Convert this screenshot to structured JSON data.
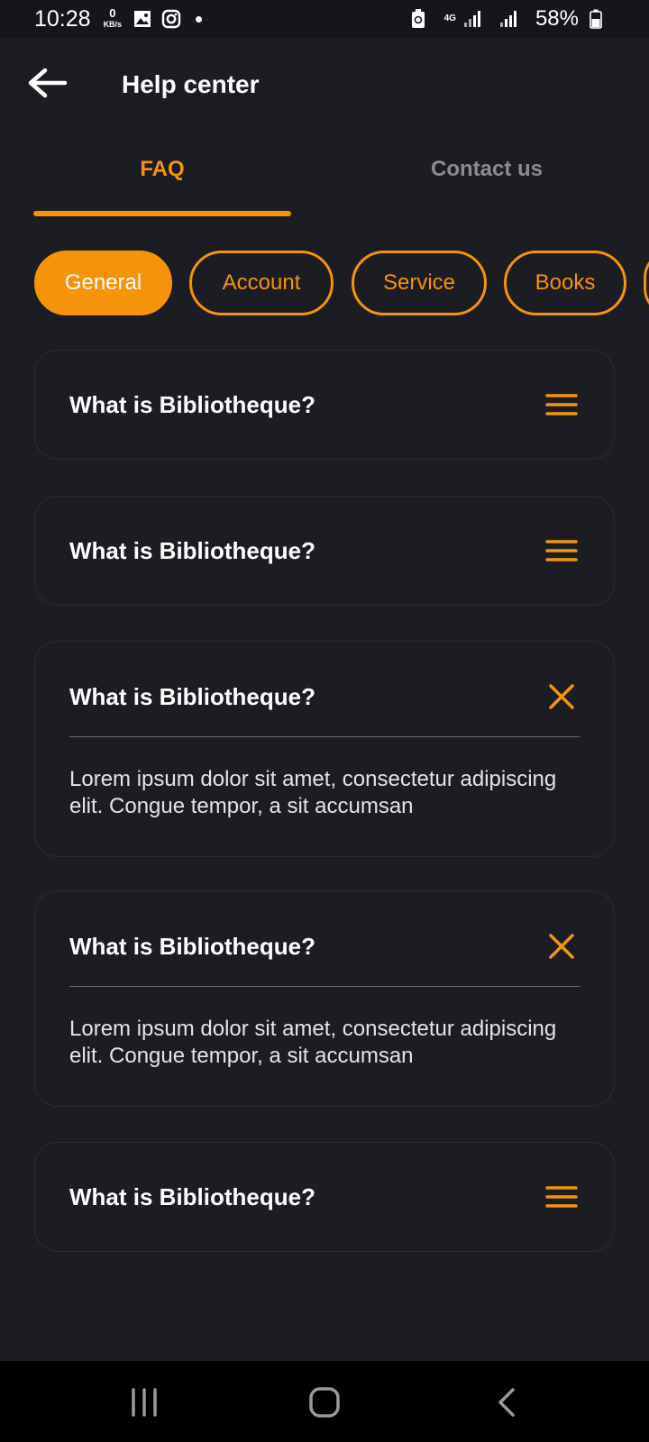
{
  "status_bar": {
    "time": "10:28",
    "speed_value": "0",
    "speed_unit": "KB/s",
    "network": "4G",
    "battery": "58%"
  },
  "header": {
    "title": "Help center",
    "back_icon": "arrow-left-icon"
  },
  "tabs": [
    {
      "label": "FAQ",
      "active": true
    },
    {
      "label": "Contact us",
      "active": false
    }
  ],
  "categories": [
    {
      "label": "General",
      "active": true
    },
    {
      "label": "Account",
      "active": false
    },
    {
      "label": "Service",
      "active": false
    },
    {
      "label": "Books",
      "active": false
    }
  ],
  "faq": [
    {
      "question": "What is Bibliotheque?",
      "expanded": false,
      "answer": ""
    },
    {
      "question": "What is Bibliotheque?",
      "expanded": false,
      "answer": ""
    },
    {
      "question": "What is Bibliotheque?",
      "expanded": true,
      "answer": "Lorem ipsum dolor sit amet, consectetur adipiscing elit. Congue tempor, a sit accumsan"
    },
    {
      "question": "What is Bibliotheque?",
      "expanded": true,
      "answer": "Lorem ipsum dolor sit amet, consectetur adipiscing elit. Congue tempor, a sit accumsan"
    },
    {
      "question": "What is Bibliotheque?",
      "expanded": false,
      "answer": ""
    }
  ],
  "colors": {
    "accent": "#f5930b",
    "background": "#1c1d22",
    "inactive_tab": "#8b8c90"
  },
  "nav_bar": {
    "recents_icon": "recents-icon",
    "home_icon": "home-icon",
    "back_icon": "back-chevron-icon"
  }
}
